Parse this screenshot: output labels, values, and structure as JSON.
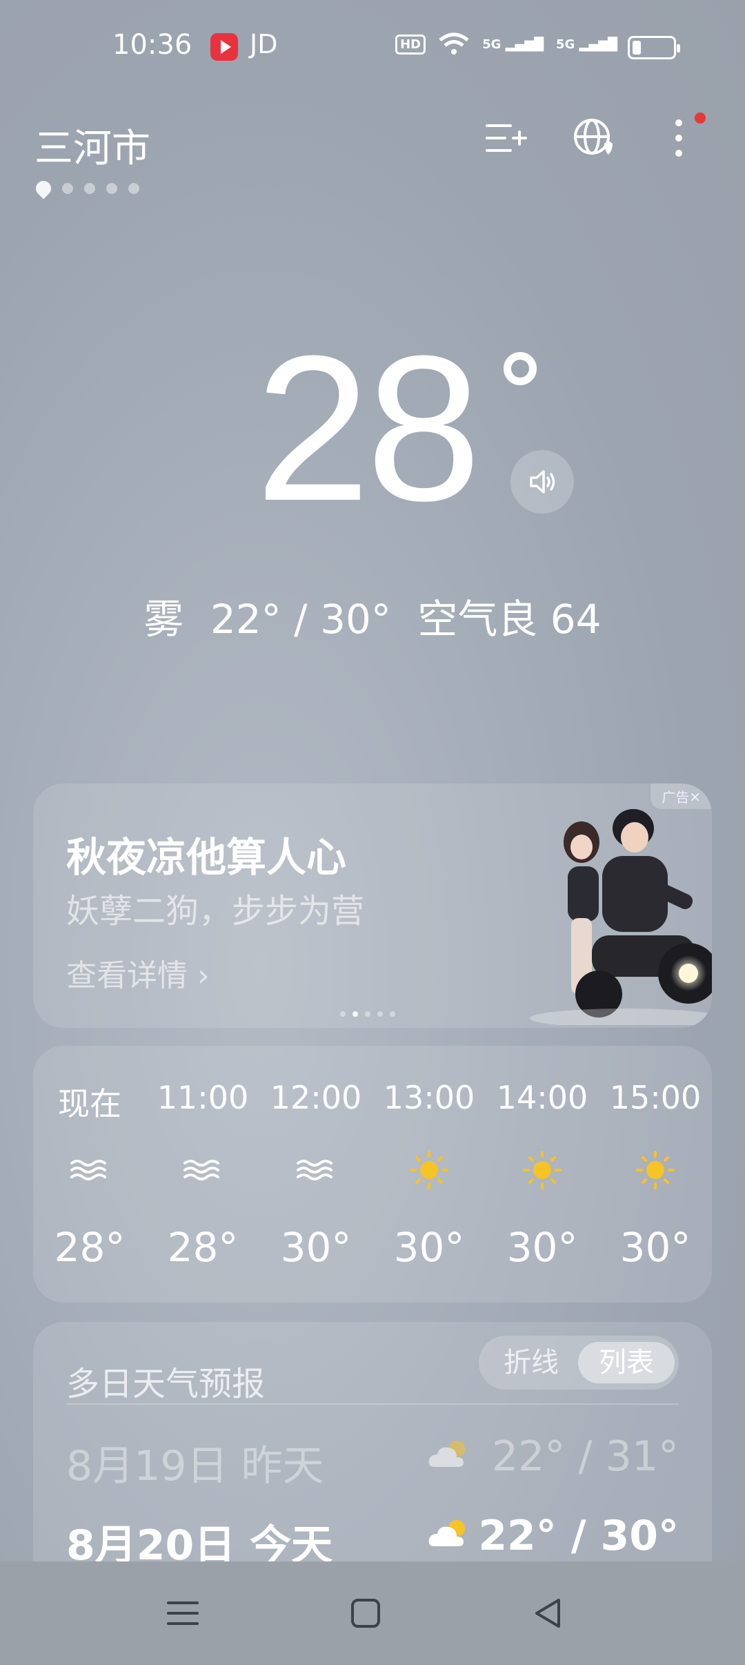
{
  "status_bar": {
    "time": "10:36",
    "app_label": "JD",
    "hd": "HD",
    "signal1": "5G",
    "signal2": "5G"
  },
  "header": {
    "city": "三河市",
    "icons": [
      "add-city-icon",
      "globe-icon",
      "more-icon"
    ]
  },
  "current": {
    "temperature": "28",
    "condition": "雾",
    "range": "22° / 30°",
    "air_quality": "空气良 64"
  },
  "ad": {
    "tag": "广告✕",
    "title": "秋夜凉他算人心",
    "subtitle": "妖孽二狗，步步为营",
    "link": "查看详情 ›"
  },
  "hourly": [
    {
      "time": "现在",
      "icon": "fog-icon",
      "temp": "28°"
    },
    {
      "time": "11:00",
      "icon": "fog-icon",
      "temp": "28°"
    },
    {
      "time": "12:00",
      "icon": "fog-icon",
      "temp": "30°"
    },
    {
      "time": "13:00",
      "icon": "sun-icon",
      "temp": "30°"
    },
    {
      "time": "14:00",
      "icon": "sun-icon",
      "temp": "30°"
    },
    {
      "time": "15:00",
      "icon": "sun-icon",
      "temp": "30°"
    }
  ],
  "forecast": {
    "title": "多日天气预报",
    "toggle_line": "折线",
    "toggle_list": "列表",
    "days": [
      {
        "date": "8月19日 昨天",
        "icon": "partly-cloudy-icon",
        "range": "22° / 31°"
      },
      {
        "date": "8月20日 今天",
        "icon": "partly-cloudy-icon",
        "range": "22° / 30°"
      }
    ]
  },
  "colors": {
    "sun": "#F7C325",
    "notification": "#E53935"
  }
}
